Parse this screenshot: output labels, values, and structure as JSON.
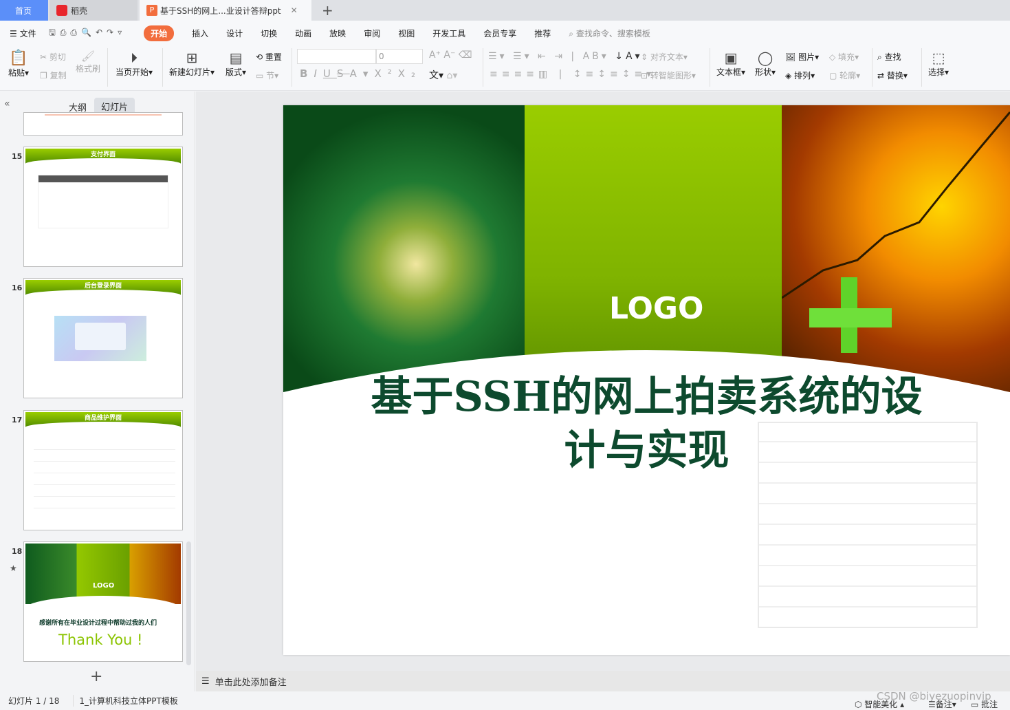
{
  "tabs": {
    "home": "首页",
    "daoke": "稻壳",
    "doc": "基于SSH的网上...业设计答辩ppt"
  },
  "menu": {
    "file": "文件",
    "items": [
      "开始",
      "插入",
      "设计",
      "切换",
      "动画",
      "放映",
      "审阅",
      "视图",
      "开发工具",
      "会员专享",
      "推荐"
    ],
    "search_placeholder": "查找命令、搜索模板"
  },
  "ribbon": {
    "paste": "粘贴",
    "cut": "剪切",
    "copy": "复制",
    "format_painter": "格式刷",
    "play_current": "当页开始",
    "new_slide": "新建幻灯片",
    "layout": "版式",
    "reset": "重置",
    "section": "节",
    "font_size": "0",
    "align_text": "对齐文本",
    "smart_shape": "转智能图形",
    "text_box": "文本框",
    "shape": "形状",
    "picture": "图片",
    "arrange": "排列",
    "fill": "填充",
    "outline": "轮廓",
    "find": "查找",
    "replace": "替换",
    "select": "选择"
  },
  "panel": {
    "tab_outline": "大纲",
    "tab_slides": "幻灯片",
    "add": "+"
  },
  "thumbs": [
    {
      "num": "15",
      "title": "支付界面"
    },
    {
      "num": "16",
      "title": "后台登录界面"
    },
    {
      "num": "17",
      "title": "商品维护界面"
    },
    {
      "num": "18",
      "logo": "LOGO",
      "caption": "感谢所有在毕业设计过程中帮助过我的人们",
      "thanks": "Thank You !"
    }
  ],
  "slide": {
    "logo": "LOGO",
    "title_line1": "基于SSH的网上拍卖系统的设",
    "title_line2": "计与实现",
    "title_color": "#0d4a2e"
  },
  "notes": {
    "placeholder": "单击此处添加备注"
  },
  "status": {
    "slide_count": "幻灯片 1 / 18",
    "template": "1_计算机科技立体PPT模板",
    "beautify": "智能美化",
    "notes": "备注",
    "comment": "批注",
    "watermark": "CSDN @biyezuopinvip"
  },
  "colors": {
    "accent": "#f26d3d",
    "home_tab": "#5b8ff9"
  }
}
